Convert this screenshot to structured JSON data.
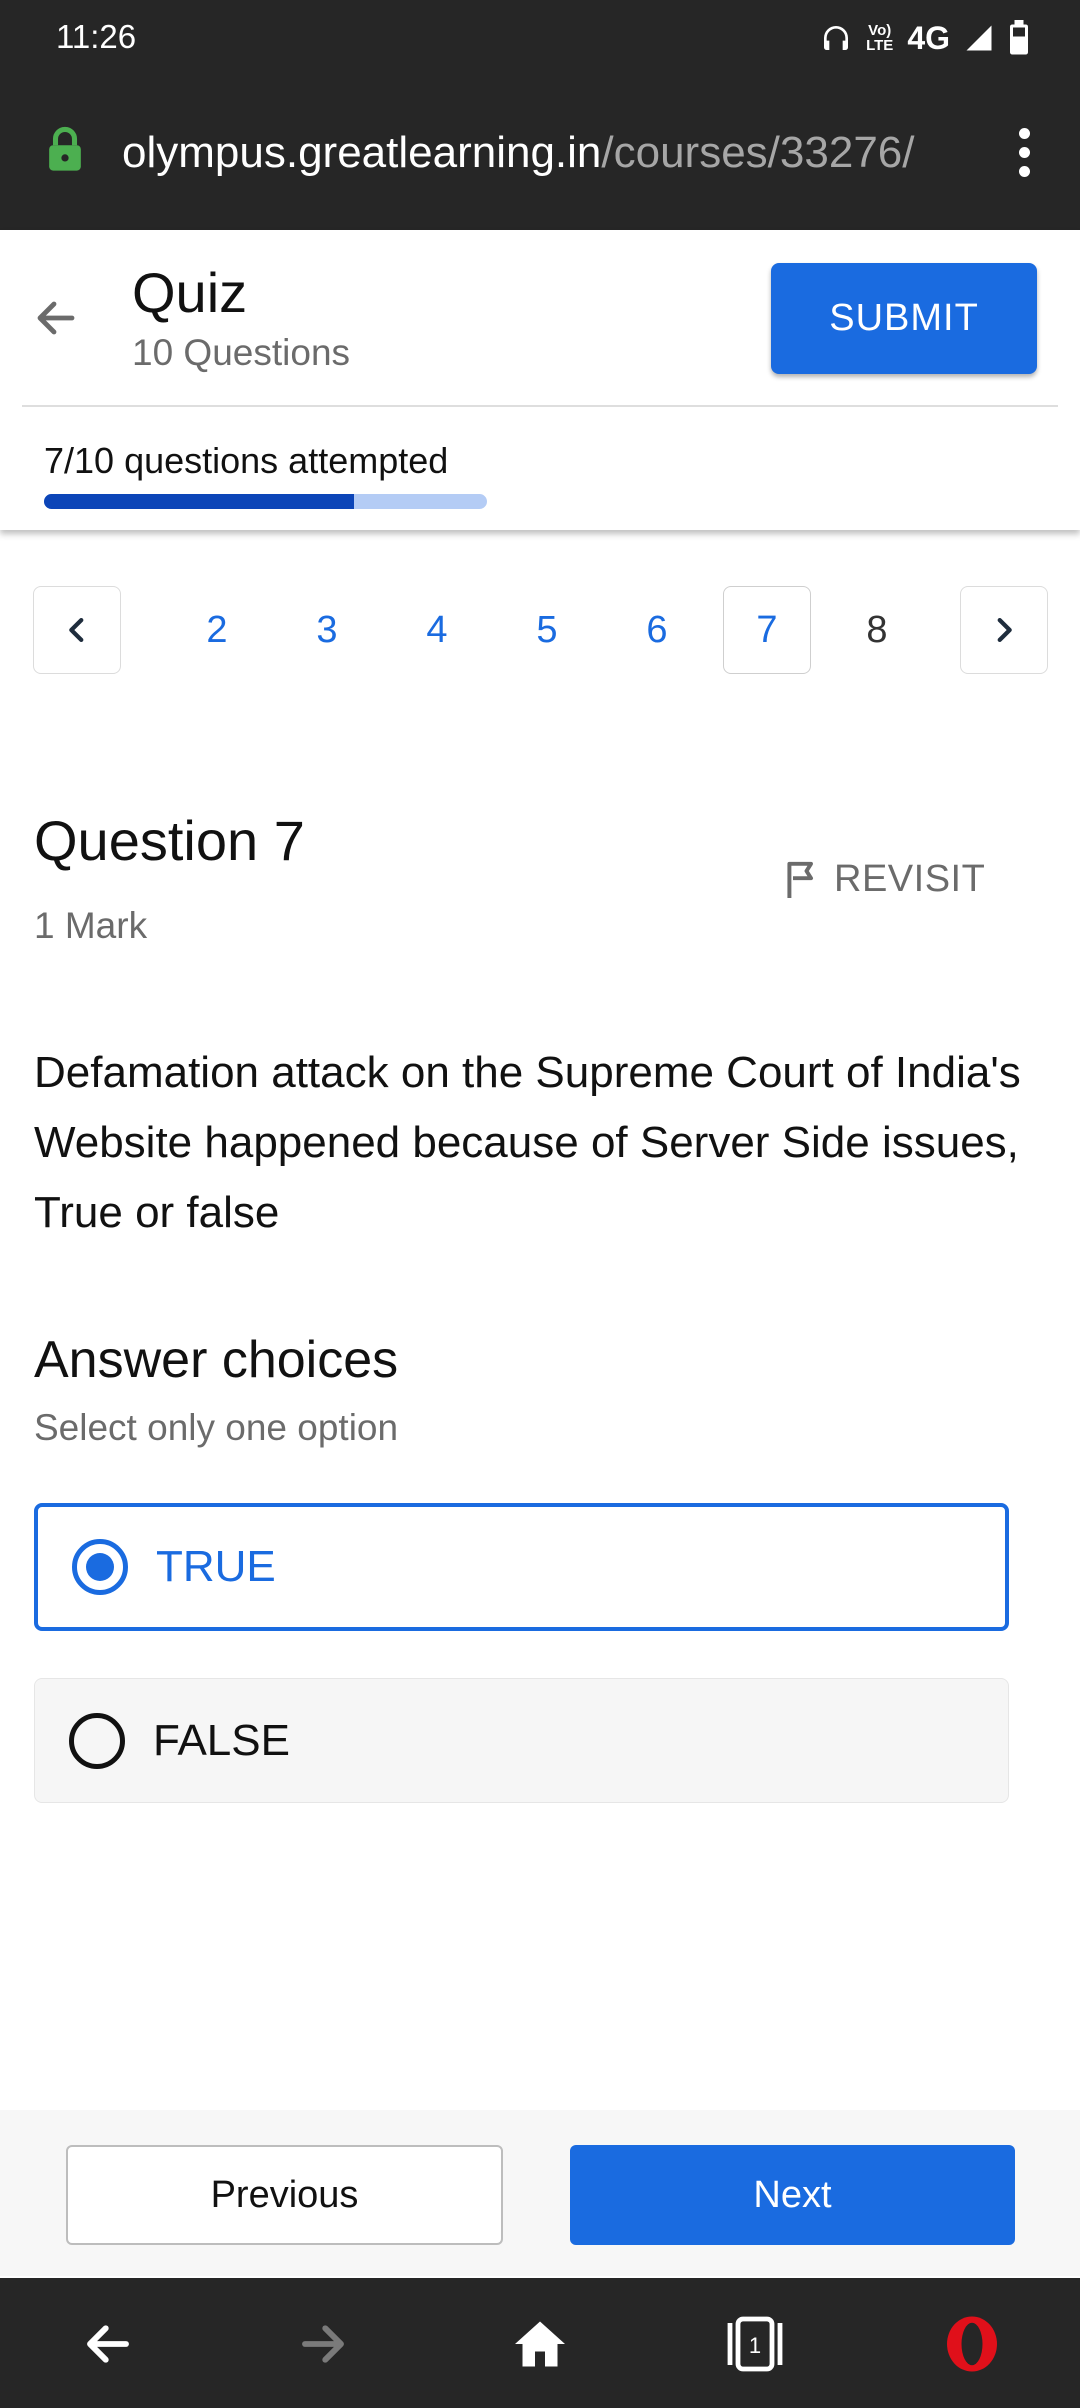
{
  "status_bar": {
    "time": "11:26",
    "network": "4G",
    "volte": "Vo LTE",
    "icons": [
      "headphones-icon",
      "volte-icon",
      "signal-icon",
      "battery-icon"
    ]
  },
  "browser": {
    "url_domain": "olympus.greatlearning.in",
    "url_path": "/courses/33276/",
    "tab_count": "1",
    "lock_color": "#4caf50"
  },
  "header": {
    "title": "Quiz",
    "subtitle": "10 Questions",
    "submit_label": "SUBMIT",
    "attempted_text": "7/10 questions attempted",
    "progress": 0.7
  },
  "pager": {
    "pages": [
      "2",
      "3",
      "4",
      "5",
      "6",
      "7",
      "8"
    ],
    "current": "7"
  },
  "question": {
    "title": "Question 7",
    "marks": "1 Mark",
    "revisit_label": "REVISIT",
    "text": "Defamation attack on the Supreme Court of India's Website happened because of Server Side issues, True or false"
  },
  "answers": {
    "heading": "Answer choices",
    "help": "Select only one option",
    "options": [
      {
        "label": "TRUE",
        "selected": true
      },
      {
        "label": "FALSE",
        "selected": false
      }
    ]
  },
  "footer": {
    "previous_label": "Previous",
    "next_label": "Next"
  },
  "colors": {
    "accent": "#1a6be0",
    "progress_fill": "#0c45b8",
    "progress_track": "#b4ccf5",
    "browser_bar": "#262626",
    "opera_red": "#e0101a"
  }
}
